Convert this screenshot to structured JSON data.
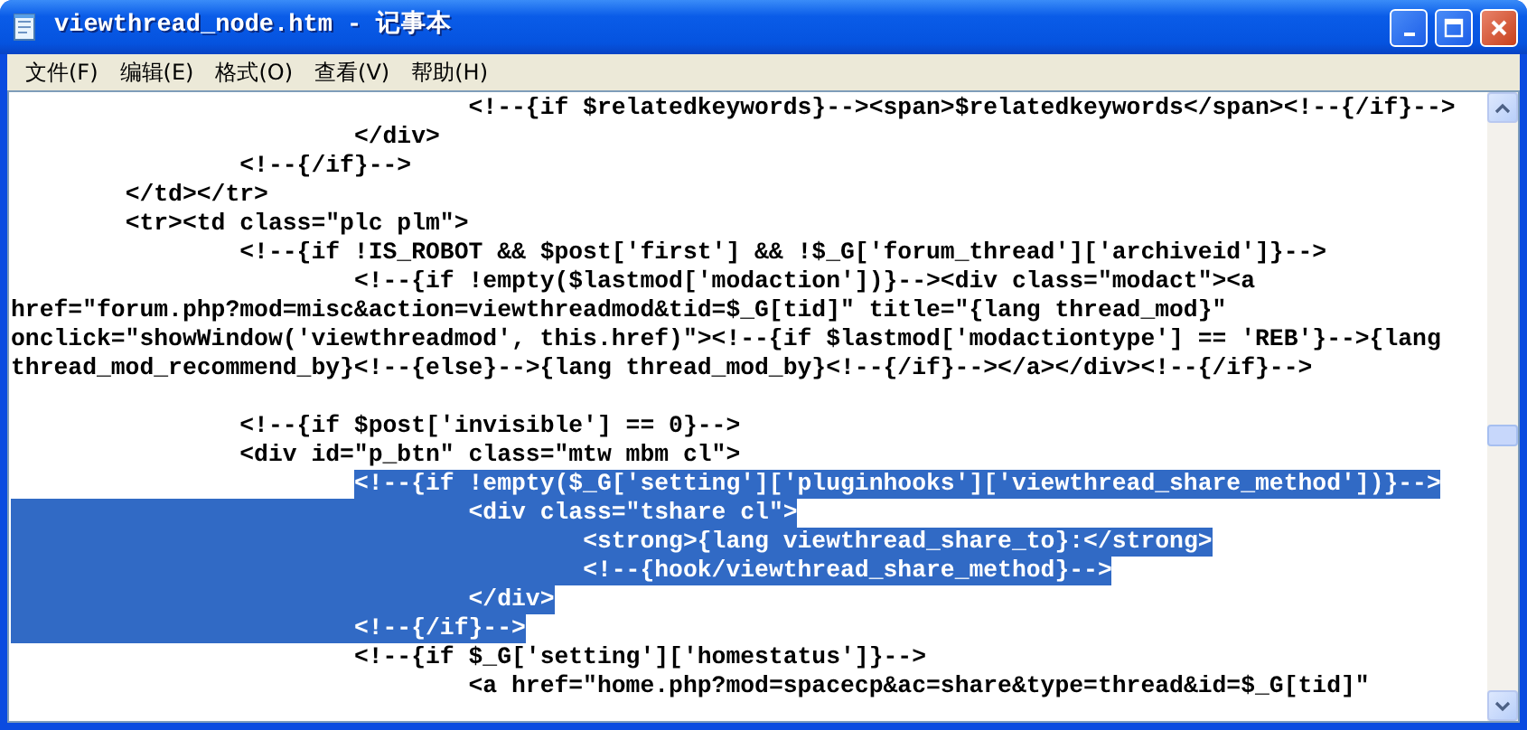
{
  "window": {
    "title": "viewthread_node.htm - 记事本"
  },
  "menu": [
    "文件(F)",
    "编辑(E)",
    "格式(O)",
    "查看(V)",
    "帮助(H)"
  ],
  "lines": [
    {
      "kind": "code",
      "text": "\t\t\t\t<!--{if $relatedkeywords}--><span>$relatedkeywords</span><!--{/if}-->",
      "selected": false,
      "indent_selected": false
    },
    {
      "kind": "code",
      "text": "\t\t\t</div>",
      "selected": false,
      "indent_selected": false
    },
    {
      "kind": "code",
      "text": "\t\t<!--{/if}-->",
      "selected": false,
      "indent_selected": false
    },
    {
      "kind": "code",
      "text": "\t</td></tr>",
      "selected": false,
      "indent_selected": false
    },
    {
      "kind": "code",
      "text": "\t<tr><td class=\"plc plm\">",
      "selected": false,
      "indent_selected": false
    },
    {
      "kind": "code",
      "text": "\t\t<!--{if !IS_ROBOT && $post['first'] && !$_G['forum_thread']['archiveid']}-->",
      "selected": false,
      "indent_selected": false
    },
    {
      "kind": "code",
      "text": "\t\t\t<!--{if !empty($lastmod['modaction'])}--><div class=\"modact\"><a",
      "selected": false,
      "indent_selected": false
    },
    {
      "kind": "code",
      "text": "href=\"forum.php?mod=misc&action=viewthreadmod&tid=$_G[tid]\" title=\"{lang thread_mod}\"",
      "selected": false
    },
    {
      "kind": "code",
      "text": "onclick=\"showWindow('viewthreadmod', this.href)\"><!--{if $lastmod['modactiontype'] == 'REB'}-->{lang",
      "selected": false
    },
    {
      "kind": "code",
      "text": "thread_mod_recommend_by}<!--{else}-->{lang thread_mod_by}<!--{/if}--></a></div><!--{/if}-->",
      "selected": false
    },
    {
      "kind": "blank"
    },
    {
      "kind": "code",
      "text": "\t\t<!--{if $post['invisible'] == 0}-->",
      "selected": false,
      "indent_selected": false
    },
    {
      "kind": "code",
      "text": "\t\t<div id=\"p_btn\" class=\"mtw mbm cl\">",
      "selected": false,
      "indent_selected": false
    },
    {
      "kind": "code",
      "text": "\t\t\t<!--{if !empty($_G['setting']['pluginhooks']['viewthread_share_method'])}-->",
      "selected": true,
      "indent_selected": false
    },
    {
      "kind": "code",
      "text": "\t\t\t\t<div class=\"tshare cl\">",
      "selected": true,
      "indent_selected": true
    },
    {
      "kind": "code",
      "text": "\t\t\t\t\t<strong>{lang viewthread_share_to}:</strong>",
      "selected": true,
      "indent_selected": true
    },
    {
      "kind": "code",
      "text": "\t\t\t\t\t<!--{hook/viewthread_share_method}-->",
      "selected": true,
      "indent_selected": true
    },
    {
      "kind": "code",
      "text": "\t\t\t\t</div>",
      "selected": true,
      "indent_selected": true
    },
    {
      "kind": "code",
      "text": "\t\t\t<!--{/if}-->",
      "selected": true,
      "indent_selected": true
    },
    {
      "kind": "code",
      "text": "\t\t\t<!--{if $_G['setting']['homestatus']}-->",
      "selected": false,
      "indent_selected": false
    },
    {
      "kind": "code",
      "text": "\t\t\t\t<a href=\"home.php?mod=spacecp&ac=share&type=thread&id=$_G[tid]\"",
      "selected": false,
      "indent_selected": false
    }
  ]
}
